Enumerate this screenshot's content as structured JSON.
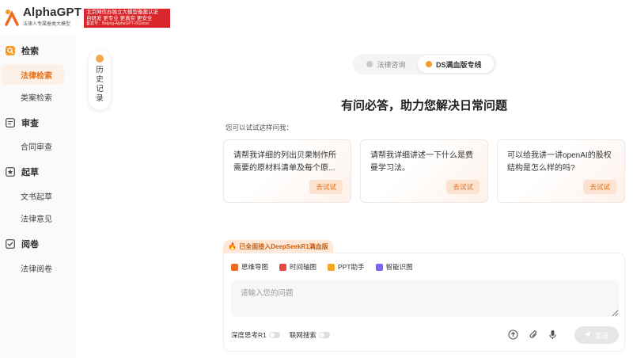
{
  "brand": {
    "name": "AlphaGPT",
    "tagline": "法律人专属垂类大模型",
    "cert_line1": "北京网信办独立大模型备案认证",
    "cert_line2": "自研发  更专业  更真实  更安全",
    "cert_line3": "备案号：Beijing-AlphaGPT-202xxxx"
  },
  "sidebar": {
    "sections": [
      {
        "label": "检索",
        "icon": "search-icon",
        "items": [
          "法律检索",
          "类案检索"
        ]
      },
      {
        "label": "审查",
        "icon": "review-icon",
        "items": [
          "合同审查"
        ]
      },
      {
        "label": "起草",
        "icon": "star-icon",
        "items": [
          "文书起草",
          "法律意见"
        ]
      },
      {
        "label": "阅卷",
        "icon": "check-icon",
        "items": [
          "法律阅卷"
        ]
      }
    ],
    "active_item": "法律检索"
  },
  "history": {
    "label": "历史记录"
  },
  "modes": {
    "law": "法律咨询",
    "ds": "DS满血版专线",
    "active": "ds"
  },
  "main": {
    "title": "有问必答，助力您解决日常问题",
    "hint": "您可以试试这样问我："
  },
  "cards": [
    {
      "text": "请帮我详细的列出贝果制作所需要的原材料清单及每个原...",
      "action": "去试试"
    },
    {
      "text": "请帮我详细讲述一下什么是费曼学习法。",
      "action": "去试试"
    },
    {
      "text": "可以给我讲一讲openAI的股权结构是怎么样的吗?",
      "action": "去试试"
    }
  ],
  "badge": "已全面接入DeepSeekR1满血版",
  "tools": [
    {
      "label": "思维导图",
      "color": "#f06a1f"
    },
    {
      "label": "时间轴图",
      "color": "#e84a4a"
    },
    {
      "label": "PPT助手",
      "color": "#f5a623"
    },
    {
      "label": "智能识图",
      "color": "#7b61ff"
    }
  ],
  "input": {
    "placeholder": "请输入您的问题",
    "value": ""
  },
  "options": {
    "deep_think": "深度思考R1",
    "web_search": "联网搜索"
  },
  "send_label": "发送",
  "colors": {
    "accent": "#e0711e",
    "active_bg": "#fdf0e6",
    "cert_red": "#d8262b"
  }
}
